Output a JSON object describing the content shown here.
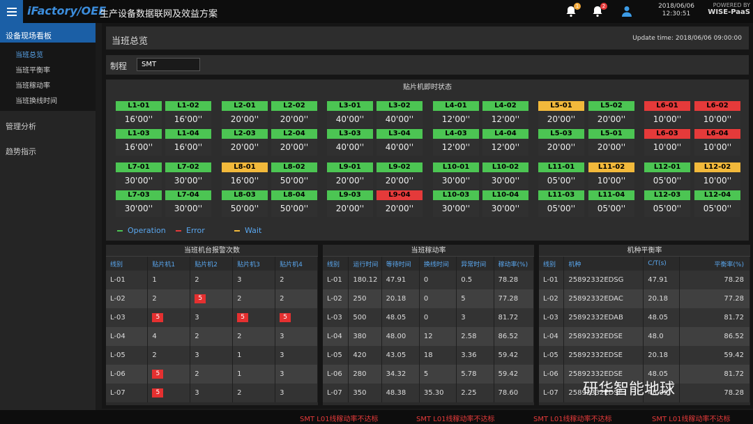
{
  "header": {
    "brand": "iFactory/OEE",
    "title": "生产设备数据联网及效益方案",
    "notif1_count": "1",
    "notif2_count": "2",
    "date": "2018/06/06",
    "time": "12:30:51",
    "powered_by": "POWERED BY",
    "platform": "WISE-PaaS"
  },
  "sidebar": {
    "group_active": "设备现场看板",
    "subs": [
      "当班总览",
      "当班平衡率",
      "当班稼动率",
      "当班换线时间"
    ],
    "groups": [
      "管理分析",
      "趋势指示"
    ]
  },
  "overview": {
    "title": "当班总览",
    "update": "Update time: 2018/06/06 09:00:00",
    "process_label": "制程",
    "process_value": "SMT"
  },
  "status": {
    "title": "贴片机即时状态",
    "tiles": [
      {
        "n": "L1-01",
        "v": "16'00''",
        "s": "g"
      },
      {
        "n": "L1-02",
        "v": "16'00''",
        "s": "g"
      },
      {
        "n": "L2-01",
        "v": "20'00''",
        "s": "g"
      },
      {
        "n": "L2-02",
        "v": "20'00''",
        "s": "g"
      },
      {
        "n": "L3-01",
        "v": "40'00''",
        "s": "g"
      },
      {
        "n": "L3-02",
        "v": "40'00''",
        "s": "g"
      },
      {
        "n": "L4-01",
        "v": "12'00''",
        "s": "g"
      },
      {
        "n": "L4-02",
        "v": "12'00''",
        "s": "g"
      },
      {
        "n": "L5-01",
        "v": "20'00''",
        "s": "y"
      },
      {
        "n": "L5-02",
        "v": "20'00''",
        "s": "g"
      },
      {
        "n": "L6-01",
        "v": "10'00''",
        "s": "r"
      },
      {
        "n": "L6-02",
        "v": "10'00''",
        "s": "r"
      },
      {
        "n": "L1-03",
        "v": "16'00''",
        "s": "g"
      },
      {
        "n": "L1-04",
        "v": "16'00''",
        "s": "g"
      },
      {
        "n": "L2-03",
        "v": "20'00''",
        "s": "g"
      },
      {
        "n": "L2-04",
        "v": "20'00''",
        "s": "g"
      },
      {
        "n": "L3-03",
        "v": "40'00''",
        "s": "g"
      },
      {
        "n": "L3-04",
        "v": "40'00''",
        "s": "g"
      },
      {
        "n": "L4-03",
        "v": "12'00''",
        "s": "g"
      },
      {
        "n": "L4-04",
        "v": "12'00''",
        "s": "g"
      },
      {
        "n": "L5-03",
        "v": "20'00''",
        "s": "g"
      },
      {
        "n": "L5-01",
        "v": "20'00''",
        "s": "g"
      },
      {
        "n": "L6-03",
        "v": "10'00''",
        "s": "r"
      },
      {
        "n": "L6-04",
        "v": "10'00''",
        "s": "r"
      },
      {
        "n": "L7-01",
        "v": "30'00''",
        "s": "g"
      },
      {
        "n": "L7-02",
        "v": "30'00''",
        "s": "g"
      },
      {
        "n": "L8-01",
        "v": "16'00''",
        "s": "y"
      },
      {
        "n": "L8-02",
        "v": "50'00''",
        "s": "g"
      },
      {
        "n": "L9-01",
        "v": "20'00''",
        "s": "g"
      },
      {
        "n": "L9-02",
        "v": "20'00''",
        "s": "g"
      },
      {
        "n": "L10-01",
        "v": "30'00''",
        "s": "g"
      },
      {
        "n": "L10-02",
        "v": "30'00''",
        "s": "g"
      },
      {
        "n": "L11-01",
        "v": "05'00''",
        "s": "g"
      },
      {
        "n": "L11-02",
        "v": "10'00''",
        "s": "y"
      },
      {
        "n": "L12-01",
        "v": "05'00''",
        "s": "g"
      },
      {
        "n": "L12-02",
        "v": "10'00''",
        "s": "y"
      },
      {
        "n": "L7-03",
        "v": "30'00''",
        "s": "g"
      },
      {
        "n": "L7-04",
        "v": "30'00''",
        "s": "g"
      },
      {
        "n": "L8-03",
        "v": "50'00''",
        "s": "g"
      },
      {
        "n": "L8-04",
        "v": "50'00''",
        "s": "g"
      },
      {
        "n": "L9-03",
        "v": "20'00''",
        "s": "g"
      },
      {
        "n": "L9-04",
        "v": "20'00''",
        "s": "r"
      },
      {
        "n": "L10-03",
        "v": "30'00''",
        "s": "g"
      },
      {
        "n": "L10-04",
        "v": "30'00''",
        "s": "g"
      },
      {
        "n": "L11-03",
        "v": "05'00''",
        "s": "g"
      },
      {
        "n": "L11-04",
        "v": "05'00''",
        "s": "g"
      },
      {
        "n": "L12-03",
        "v": "05'00''",
        "s": "g"
      },
      {
        "n": "L12-04",
        "v": "05'00''",
        "s": "g"
      }
    ],
    "legend": {
      "operation": "Operation",
      "error": "Error",
      "wait": "Wait"
    },
    "colors": {
      "green": "#4cc553",
      "red": "#e53a3a",
      "yellow": "#f2b93b"
    }
  },
  "alarm_table": {
    "title": "当班机台报警次数",
    "headers": [
      "线别",
      "贴片机1",
      "贴片机2",
      "贴片机3",
      "贴片机4"
    ],
    "rows": [
      [
        "L-01",
        "1",
        "2",
        "3",
        "2"
      ],
      [
        "L-02",
        "2",
        "5",
        "2",
        "2"
      ],
      [
        "L-03",
        "5",
        "3",
        "5",
        "5"
      ],
      [
        "L-04",
        "4",
        "2",
        "2",
        "3"
      ],
      [
        "L-05",
        "2",
        "3",
        "1",
        "3"
      ],
      [
        "L-06",
        "5",
        "2",
        "1",
        "3"
      ],
      [
        "L-07",
        "5",
        "3",
        "2",
        "3"
      ]
    ],
    "highlight": [
      [
        1,
        2
      ],
      [
        2,
        1
      ],
      [
        2,
        3
      ],
      [
        2,
        4
      ],
      [
        5,
        1
      ],
      [
        6,
        1
      ]
    ]
  },
  "util_table": {
    "title": "当班稼动率",
    "headers": [
      "线别",
      "运行时间",
      "等待时间",
      "换线时间",
      "异常时间",
      "稼动率(%)"
    ],
    "rows": [
      [
        "L-01",
        "180.12",
        "47.91",
        "0",
        "0.5",
        "78.28"
      ],
      [
        "L-02",
        "250",
        "20.18",
        "0",
        "5",
        "77.28"
      ],
      [
        "L-03",
        "500",
        "48.05",
        "0",
        "3",
        "81.72"
      ],
      [
        "L-04",
        "380",
        "48.00",
        "12",
        "2.58",
        "86.52"
      ],
      [
        "L-05",
        "420",
        "43.05",
        "18",
        "3.36",
        "59.42"
      ],
      [
        "L-06",
        "280",
        "34.32",
        "5",
        "5.78",
        "59.42"
      ],
      [
        "L-07",
        "350",
        "48.38",
        "35.30",
        "2.25",
        "78.60"
      ]
    ]
  },
  "balance_table": {
    "title": "机种平衡率",
    "headers": [
      "线别",
      "机种",
      "C/T(s)",
      "平衡率(%)"
    ],
    "rows": [
      [
        "L-01",
        "25892332EDSG",
        "47.91",
        "78.28"
      ],
      [
        "L-02",
        "25892332EDAC",
        "20.18",
        "77.28"
      ],
      [
        "L-03",
        "25892332EDAB",
        "48.05",
        "81.72"
      ],
      [
        "L-04",
        "25892332EDSE",
        "48.0",
        "86.52"
      ],
      [
        "L-05",
        "25892332EDSE",
        "20.18",
        "59.42"
      ],
      [
        "L-06",
        "25892332EDSE",
        "48.05",
        "81.72"
      ],
      [
        "L-07",
        "25892332EDSE",
        "48.05",
        "78.28"
      ]
    ]
  },
  "ticker": [
    "SMT L01线稼动率不达标",
    "SMT L01线稼动率不达标",
    "SMT L01线稼动率不达标",
    "SMT L01线稼动率不达标"
  ],
  "watermark": "研华智能地球"
}
